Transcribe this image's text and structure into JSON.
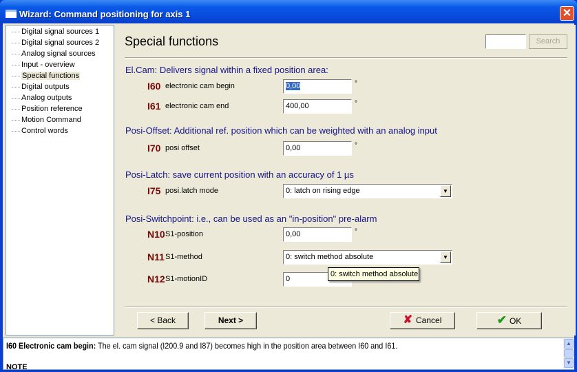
{
  "window": {
    "title": "Wizard: Command positioning for axis 1",
    "close": "✕"
  },
  "tree": {
    "items": [
      "Digital signal sources 1",
      "Digital signal sources 2",
      "Analog signal sources",
      "Input - overview",
      "Special functions",
      "Digital outputs",
      "Analog outputs",
      "Position reference",
      "Motion Command",
      "Control words"
    ],
    "selected": "Special functions"
  },
  "main": {
    "title": "Special functions",
    "search": {
      "value": "",
      "button": "Search"
    },
    "sections": [
      {
        "heading": "El.Cam: Delivers signal within a fixed position area:"
      },
      {
        "heading": "Posi-Offset: Additional ref. position which can be weighted with an analog input"
      },
      {
        "heading": "Posi-Latch: save current position with an accuracy of 1 µs"
      },
      {
        "heading": "Posi-Switchpoint: i.e., can be used as an \"in-position\" pre-alarm"
      }
    ],
    "params": {
      "I60": {
        "code": "I60",
        "label": "electronic cam begin",
        "value": "0,00",
        "unit": "°"
      },
      "I61": {
        "code": "I61",
        "label": "electronic cam end",
        "value": "400,00",
        "unit": "°"
      },
      "I70": {
        "code": "I70",
        "label": "posi offset",
        "value": "0,00",
        "unit": "°"
      },
      "I75": {
        "code": "I75",
        "label": "posi.latch mode",
        "value": "0: latch on rising edge"
      },
      "N10": {
        "code": "N10",
        "label": "S1-position",
        "value": "0,00",
        "unit": "°"
      },
      "N11": {
        "code": "N11",
        "label": "S1-method",
        "value": "0: switch method absolute"
      },
      "N12": {
        "code": "N12",
        "label": "S1-motionID",
        "value": "0"
      }
    },
    "tooltip": "0: switch method absolute",
    "buttons": {
      "back": "< Back",
      "next": "Next >",
      "cancel": "Cancel",
      "ok": "OK"
    }
  },
  "help": {
    "bold": "I60  Electronic cam begin:",
    "text": " The el. cam signal (I200.9 and I87) becomes high in the position area between I60 and I61.",
    "note": "NOTE"
  },
  "colors": {
    "code": "#7a0a0a",
    "heading": "#14148c",
    "panel": "#ece9d8",
    "titlebar": "#0a5ae8"
  }
}
